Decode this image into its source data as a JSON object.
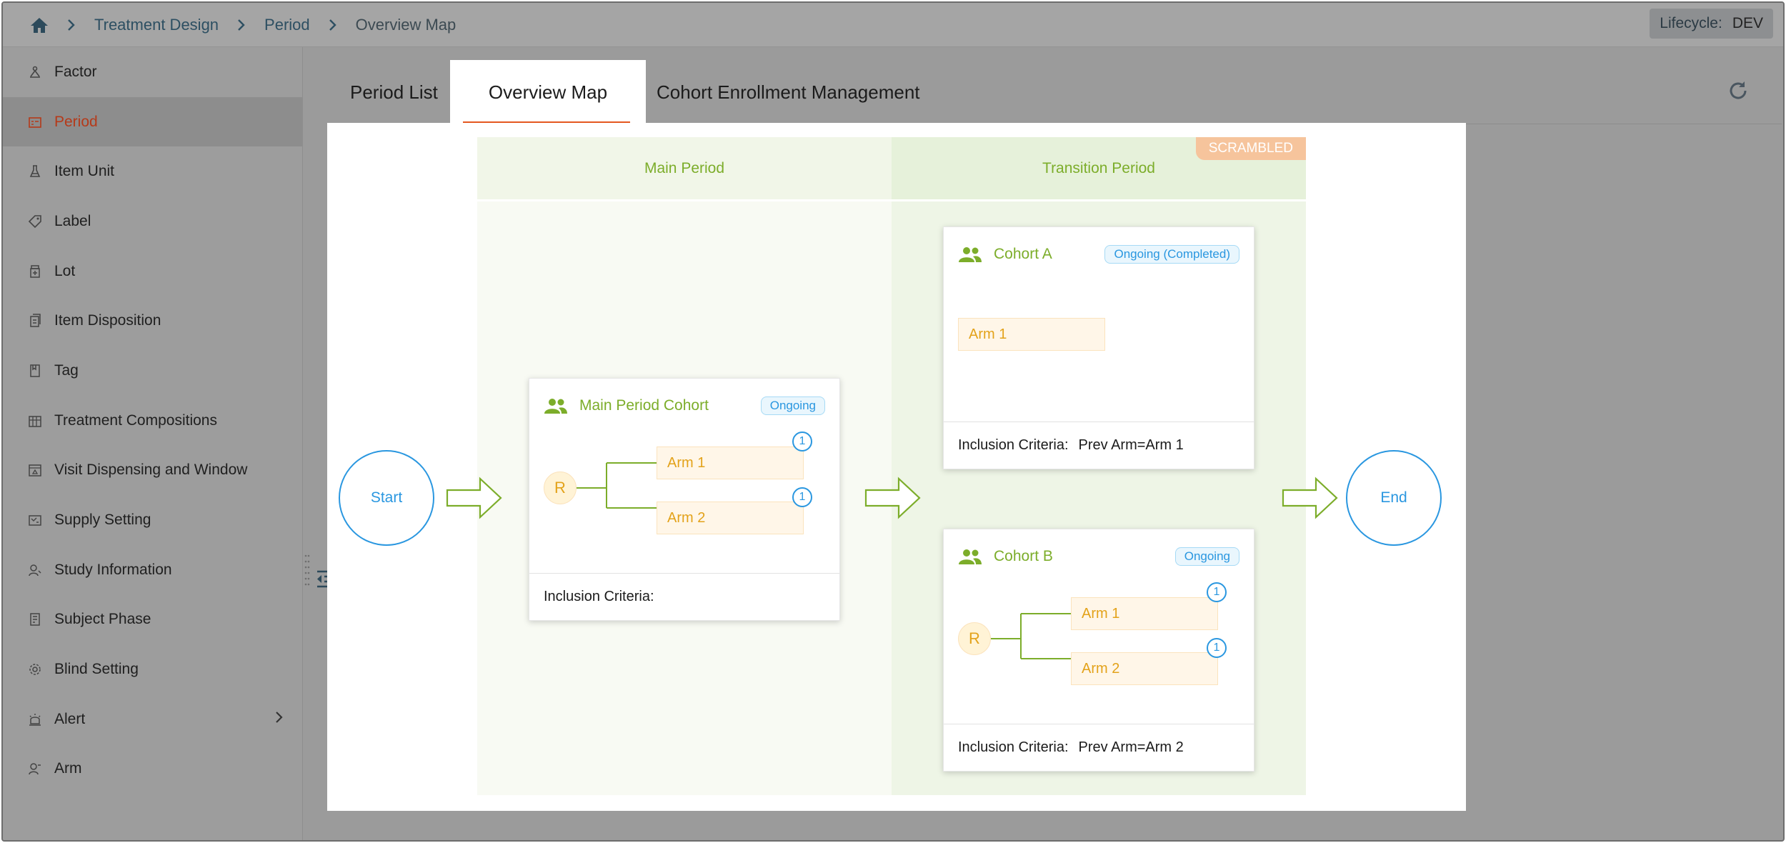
{
  "breadcrumb": {
    "home_icon": "home-icon",
    "items": [
      "Treatment Design",
      "Period",
      "Overview Map"
    ]
  },
  "lifecycle": {
    "label": "Lifecycle:",
    "value": "DEV"
  },
  "sidebar": {
    "items": [
      {
        "label": "Factor",
        "icon": "factor-icon"
      },
      {
        "label": "Period",
        "icon": "period-icon",
        "active": true
      },
      {
        "label": "Item Unit",
        "icon": "flask-icon"
      },
      {
        "label": "Label",
        "icon": "tag-label-icon"
      },
      {
        "label": "Lot",
        "icon": "lot-icon"
      },
      {
        "label": "Item Disposition",
        "icon": "disposition-icon"
      },
      {
        "label": "Tag",
        "icon": "tag-icon"
      },
      {
        "label": "Treatment Compositions",
        "icon": "compositions-icon"
      },
      {
        "label": "Visit Dispensing and Window",
        "icon": "visit-icon"
      },
      {
        "label": "Supply Setting",
        "icon": "supply-icon"
      },
      {
        "label": "Study Information",
        "icon": "study-icon"
      },
      {
        "label": "Subject Phase",
        "icon": "phase-icon"
      },
      {
        "label": "Blind Setting",
        "icon": "gear-icon"
      },
      {
        "label": "Alert",
        "icon": "alert-icon",
        "has_children": true
      },
      {
        "label": "Arm",
        "icon": "arm-icon"
      }
    ]
  },
  "tabs": {
    "period_list": "Period List",
    "overview_map": "Overview Map",
    "cohort_enrollment": "Cohort Enrollment Management"
  },
  "map": {
    "start": "Start",
    "end": "End",
    "scrambled": "SCRAMBLED",
    "main_period": {
      "title": "Main Period",
      "cohort": {
        "name": "Main Period Cohort",
        "status": "Ongoing",
        "randomizer": "R",
        "arms": [
          {
            "label": "Arm 1",
            "count": "1"
          },
          {
            "label": "Arm 2",
            "count": "1"
          }
        ],
        "criteria_label": "Inclusion Criteria:",
        "criteria_value": ""
      }
    },
    "transition_period": {
      "title": "Transition Period",
      "cohort_a": {
        "name": "Cohort A",
        "status": "Ongoing (Completed)",
        "arms": [
          {
            "label": "Arm 1"
          }
        ],
        "criteria_label": "Inclusion Criteria:",
        "criteria_value": "Prev Arm=Arm 1"
      },
      "cohort_b": {
        "name": "Cohort B",
        "status": "Ongoing",
        "randomizer": "R",
        "arms": [
          {
            "label": "Arm 1",
            "count": "1"
          },
          {
            "label": "Arm 2",
            "count": "1"
          }
        ],
        "criteria_label": "Inclusion Criteria:",
        "criteria_value": "Prev Arm=Arm 2"
      }
    }
  },
  "colors": {
    "accent": "#e4571f",
    "green": "#7cad2a",
    "blue": "#2a97e0",
    "arm_orange": "#e3a21a"
  }
}
